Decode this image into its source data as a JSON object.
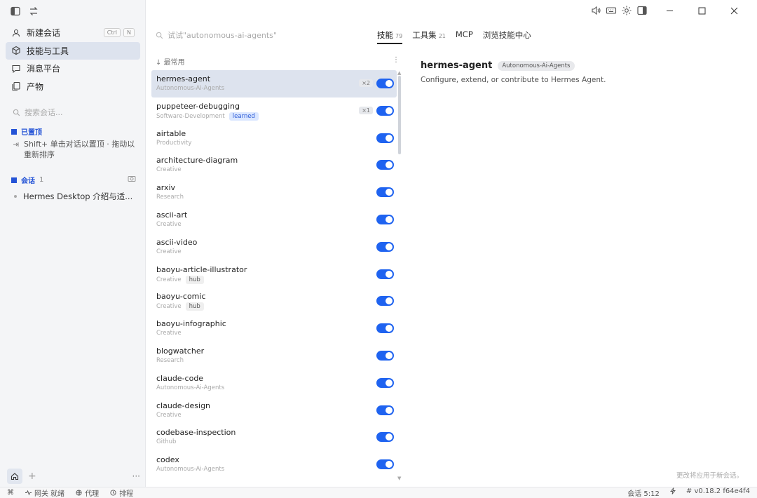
{
  "sidebar": {
    "nav": [
      {
        "label": "新建会话",
        "icon": "person-icon",
        "active": false
      },
      {
        "label": "技能与工具",
        "icon": "cube-icon",
        "active": true
      },
      {
        "label": "消息平台",
        "icon": "chat-icon",
        "active": false
      },
      {
        "label": "产物",
        "icon": "copy-icon",
        "active": false
      }
    ],
    "shortcut": [
      "Ctrl",
      "N"
    ],
    "search_placeholder": "搜索会话...",
    "pinned_title": "已置顶",
    "pin_hint": "Shift+ 单击对话以置顶 · 拖动以重新排序",
    "sessions_title": "会话",
    "sessions_count": "1",
    "session_item": "Hermes Desktop 介绍与适...",
    "more": "···",
    "plus": "+"
  },
  "statusbar": {
    "cmd": "⌘",
    "gateway": "网关 就绪",
    "proxy": "代理",
    "schedule": "排程",
    "session_time": "会话 5:12",
    "version": "# v0.18.2 f64e4f4"
  },
  "main": {
    "search_placeholder": "试试\"autonomous-ai-agents\"",
    "tabs": [
      {
        "label": "技能",
        "count": "79"
      },
      {
        "label": "工具集",
        "count": "21"
      },
      {
        "label": "MCP",
        "count": ""
      },
      {
        "label": "浏览技能中心",
        "count": ""
      }
    ],
    "sort_label": "↓ 最常用",
    "sort_more": "⋮",
    "skills": [
      {
        "name": "hermes-agent",
        "category": "Autonomous-Ai-Agents",
        "tag": "",
        "count": "×2",
        "enabled": true
      },
      {
        "name": "puppeteer-debugging",
        "category": "Software-Development",
        "tag": "learned",
        "count": "×1",
        "enabled": true
      },
      {
        "name": "airtable",
        "category": "Productivity",
        "tag": "",
        "count": "",
        "enabled": true
      },
      {
        "name": "architecture-diagram",
        "category": "Creative",
        "tag": "",
        "count": "",
        "enabled": true
      },
      {
        "name": "arxiv",
        "category": "Research",
        "tag": "",
        "count": "",
        "enabled": true
      },
      {
        "name": "ascii-art",
        "category": "Creative",
        "tag": "",
        "count": "",
        "enabled": true
      },
      {
        "name": "ascii-video",
        "category": "Creative",
        "tag": "",
        "count": "",
        "enabled": true
      },
      {
        "name": "baoyu-article-illustrator",
        "category": "Creative",
        "tag": "hub",
        "count": "",
        "enabled": true
      },
      {
        "name": "baoyu-comic",
        "category": "Creative",
        "tag": "hub",
        "count": "",
        "enabled": true
      },
      {
        "name": "baoyu-infographic",
        "category": "Creative",
        "tag": "",
        "count": "",
        "enabled": true
      },
      {
        "name": "blogwatcher",
        "category": "Research",
        "tag": "",
        "count": "",
        "enabled": true
      },
      {
        "name": "claude-code",
        "category": "Autonomous-Ai-Agents",
        "tag": "",
        "count": "",
        "enabled": true
      },
      {
        "name": "claude-design",
        "category": "Creative",
        "tag": "",
        "count": "",
        "enabled": true
      },
      {
        "name": "codebase-inspection",
        "category": "Github",
        "tag": "",
        "count": "",
        "enabled": true
      },
      {
        "name": "codex",
        "category": "Autonomous-Ai-Agents",
        "tag": "",
        "count": "",
        "enabled": true
      }
    ]
  },
  "detail": {
    "title": "hermes-agent",
    "badge": "Autonomous-Ai-Agents",
    "description": "Configure, extend, or contribute to Hermes Agent.",
    "footnote": "更改将应用于新会话。"
  },
  "colors": {
    "accent": "#1f63f0",
    "active_bg": "#dde3ee",
    "section_blue": "#2453d6"
  }
}
